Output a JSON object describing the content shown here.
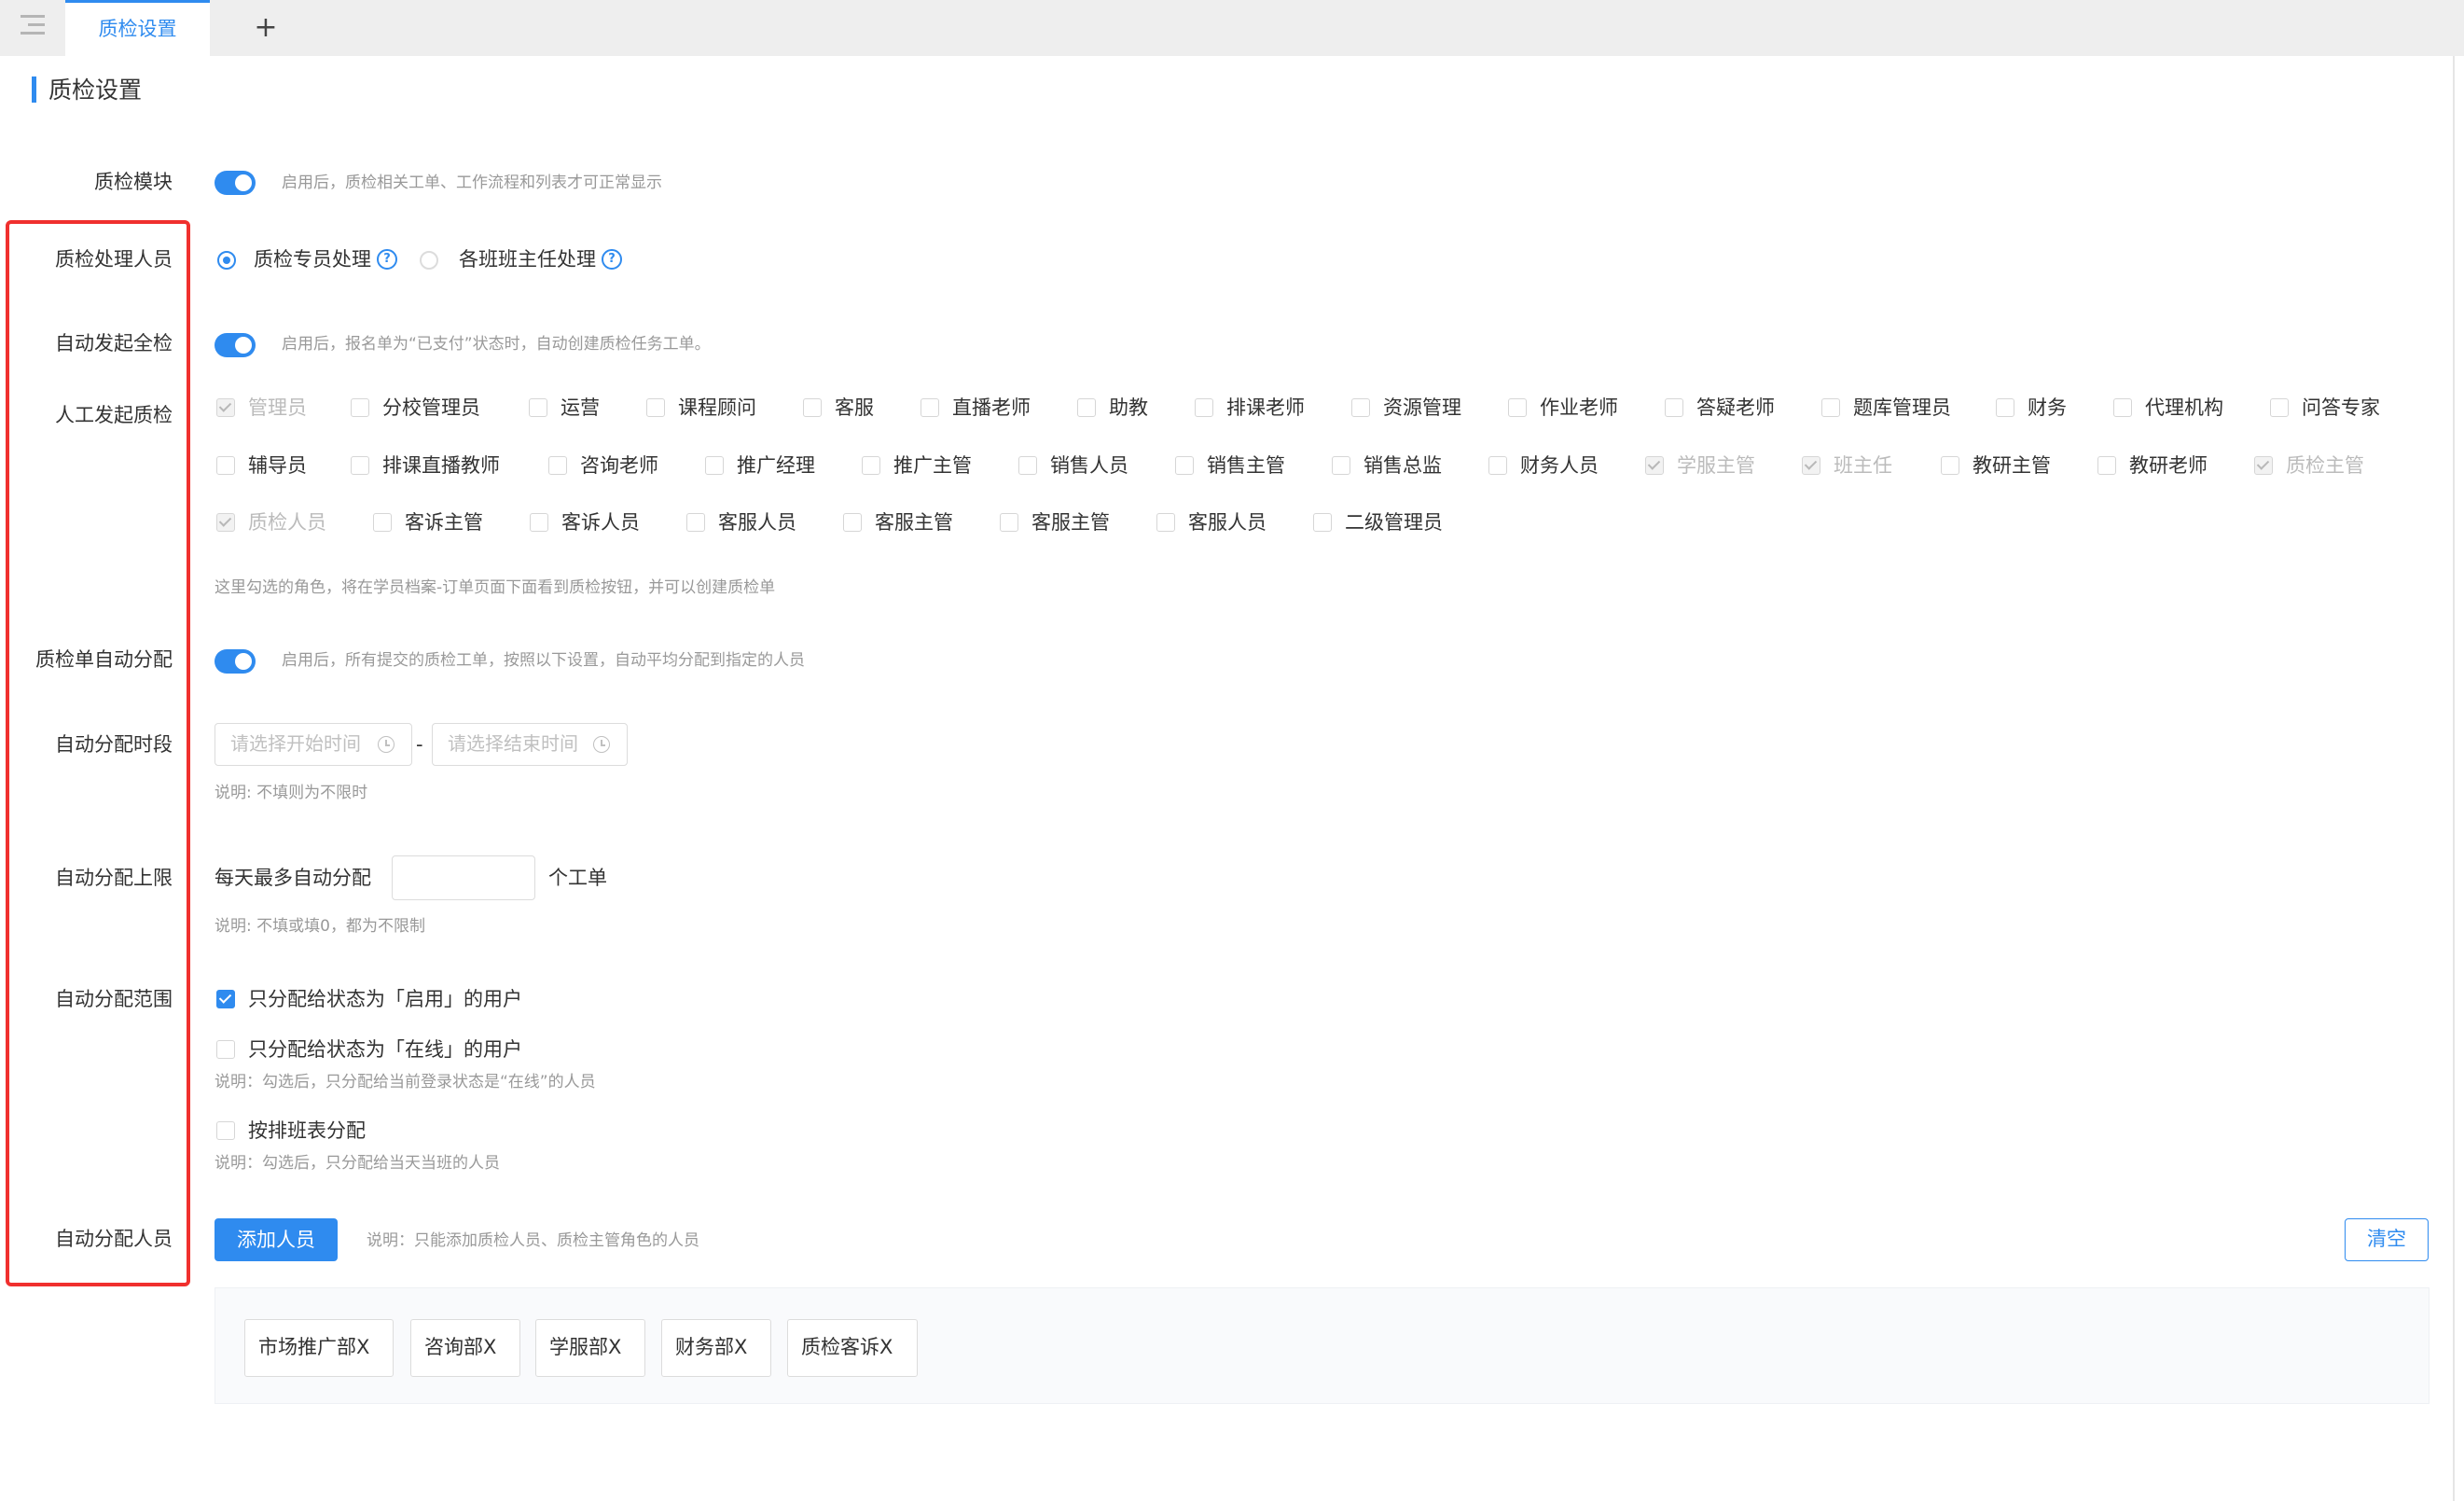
{
  "tabs": {
    "active_label": "质检设置",
    "add_label": "+"
  },
  "page": {
    "title": "质检设置"
  },
  "form": {
    "module": {
      "label": "质检模块",
      "enabled": true,
      "desc": "启用后，质检相关工单、工作流程和列表才可正常显示"
    },
    "handler": {
      "label": "质检处理人员",
      "options": [
        {
          "text": "质检专员处理",
          "selected": true
        },
        {
          "text": "各班班主任处理",
          "selected": false
        }
      ],
      "help_glyph": "?"
    },
    "auto_full": {
      "label": "自动发起全检",
      "enabled": true,
      "desc": "启用后，报名单为“已支付”状态时，自动创建质检任务工单。"
    },
    "manual": {
      "label": "人工发起质检",
      "roles": [
        {
          "text": "管理员",
          "state": "disabled-checked"
        },
        {
          "text": "分校管理员",
          "state": "unchecked"
        },
        {
          "text": "运营",
          "state": "unchecked"
        },
        {
          "text": "课程顾问",
          "state": "unchecked"
        },
        {
          "text": "客服",
          "state": "unchecked"
        },
        {
          "text": "直播老师",
          "state": "unchecked"
        },
        {
          "text": "助教",
          "state": "unchecked"
        },
        {
          "text": "排课老师",
          "state": "unchecked"
        },
        {
          "text": "资源管理",
          "state": "unchecked"
        },
        {
          "text": "作业老师",
          "state": "unchecked"
        },
        {
          "text": "答疑老师",
          "state": "unchecked"
        },
        {
          "text": "题库管理员",
          "state": "unchecked"
        },
        {
          "text": "财务",
          "state": "unchecked"
        },
        {
          "text": "代理机构",
          "state": "unchecked"
        },
        {
          "text": "问答专家",
          "state": "unchecked"
        },
        {
          "text": "辅导员",
          "state": "unchecked"
        },
        {
          "text": "排课直播教师",
          "state": "unchecked"
        },
        {
          "text": "咨询老师",
          "state": "unchecked"
        },
        {
          "text": "推广经理",
          "state": "unchecked"
        },
        {
          "text": "推广主管",
          "state": "unchecked"
        },
        {
          "text": "销售人员",
          "state": "unchecked"
        },
        {
          "text": "销售主管",
          "state": "unchecked"
        },
        {
          "text": "销售总监",
          "state": "unchecked"
        },
        {
          "text": "财务人员",
          "state": "unchecked"
        },
        {
          "text": "学服主管",
          "state": "disabled-checked"
        },
        {
          "text": "班主任",
          "state": "disabled-checked"
        },
        {
          "text": "教研主管",
          "state": "unchecked"
        },
        {
          "text": "教研老师",
          "state": "unchecked"
        },
        {
          "text": "质检主管",
          "state": "disabled-checked"
        },
        {
          "text": "质检人员",
          "state": "disabled-checked"
        },
        {
          "text": "客诉主管",
          "state": "unchecked"
        },
        {
          "text": "客诉人员",
          "state": "unchecked"
        },
        {
          "text": "客服人员",
          "state": "unchecked"
        },
        {
          "text": "客服主管",
          "state": "unchecked"
        },
        {
          "text": "客服主管",
          "state": "unchecked"
        },
        {
          "text": "客服人员",
          "state": "unchecked"
        },
        {
          "text": "二级管理员",
          "state": "unchecked"
        }
      ],
      "desc": "这里勾选的角色，将在学员档案-订单页面下面看到质检按钮，并可以创建质检单"
    },
    "auto_assign": {
      "label": "质检单自动分配",
      "enabled": true,
      "desc": "启用后，所有提交的质检工单，按照以下设置，自动平均分配到指定的人员"
    },
    "assign_period": {
      "label": "自动分配时段",
      "start_placeholder": "请选择开始时间",
      "end_placeholder": "请选择结束时间",
      "separator": "-",
      "desc": "说明: 不填则为不限时"
    },
    "assign_limit": {
      "label": "自动分配上限",
      "prefix": "每天最多自动分配",
      "value": "",
      "suffix": "个工单",
      "desc": "说明: 不填或填0，都为不限制"
    },
    "assign_scope": {
      "label": "自动分配范围",
      "options": [
        {
          "text": "只分配给状态为「启用」的用户",
          "checked": true,
          "desc": ""
        },
        {
          "text": "只分配给状态为「在线」的用户",
          "checked": false,
          "desc": "说明：勾选后，只分配给当前登录状态是“在线”的人员"
        },
        {
          "text": "按排班表分配",
          "checked": false,
          "desc": "说明：勾选后，只分配给当天当班的人员"
        }
      ]
    },
    "assign_people": {
      "label": "自动分配人员",
      "add_button": "添加人员",
      "desc": "说明：只能添加质检人员、质检主管角色的人员",
      "clear_button": "清空",
      "chips": [
        "市场推广部X",
        "咨询部X",
        "学服部X",
        "财务部X",
        "质检客诉X"
      ]
    }
  },
  "colors": {
    "accent": "#2f8bef",
    "highlight_box": "#f0302e"
  }
}
